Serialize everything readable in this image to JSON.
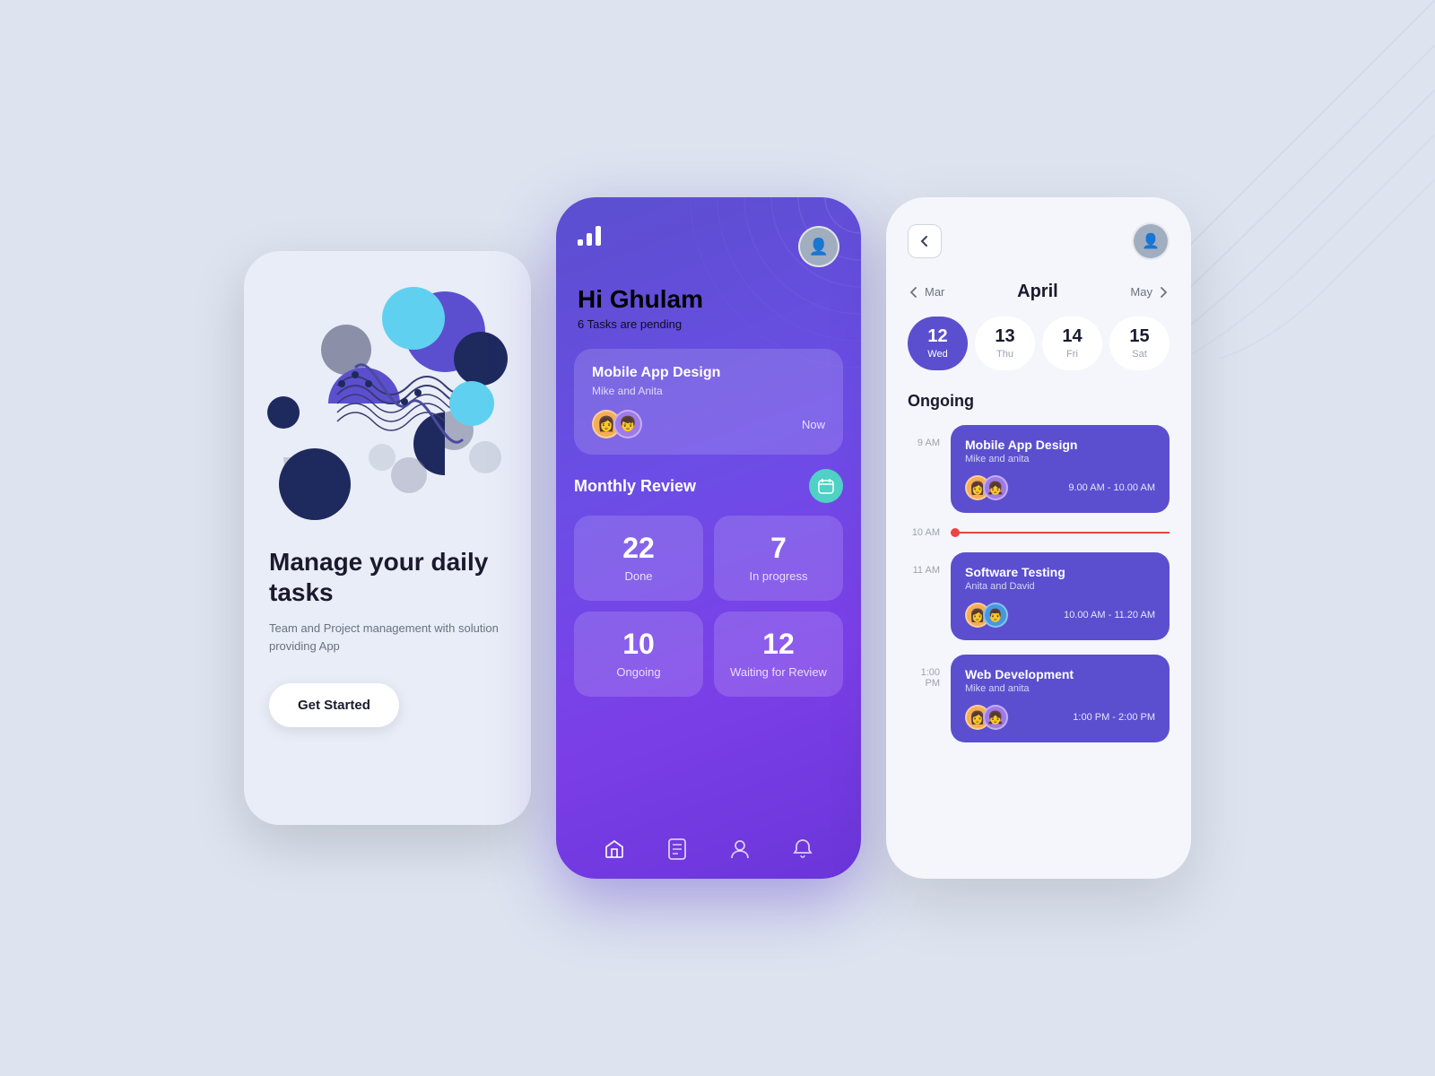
{
  "background": "#dde3ef",
  "phone1": {
    "title": "Manage your daily tasks",
    "description": "Team and Project management with solution providing App",
    "cta_label": "Get Started"
  },
  "phone2": {
    "greeting": "Hi Ghulam",
    "subtitle": "6 Tasks are pending",
    "task_card": {
      "title": "Mobile App Design",
      "people": "Mike and Anita",
      "time": "Now"
    },
    "review_section": {
      "title": "Monthly Review",
      "stats": [
        {
          "number": "22",
          "label": "Done"
        },
        {
          "number": "7",
          "label": "In progress"
        },
        {
          "number": "10",
          "label": "Ongoing"
        },
        {
          "number": "12",
          "label": "Waiting for Review"
        }
      ]
    },
    "nav_icons": [
      "home",
      "doc",
      "user",
      "bell"
    ]
  },
  "phone3": {
    "month": "April",
    "prev_month": "Mar",
    "next_month": "May",
    "days": [
      {
        "number": "12",
        "name": "Wed",
        "active": true
      },
      {
        "number": "13",
        "name": "Thu",
        "active": false
      },
      {
        "number": "14",
        "name": "Fri",
        "active": false
      },
      {
        "number": "15",
        "name": "Sat",
        "active": false
      }
    ],
    "ongoing_title": "Ongoing",
    "events": [
      {
        "time_label": "9 AM",
        "title": "Mobile App Design",
        "people": "Mike and anita",
        "time_range": "9.00 AM - 10.00 AM"
      },
      {
        "time_label": "11 AM",
        "title": "Software Testing",
        "people": "Anita and David",
        "time_range": "10.00 AM - 11.20 AM"
      },
      {
        "time_label": "1:00 PM",
        "title": "Web Development",
        "people": "Mike and anita",
        "time_range": "1:00 PM - 2:00 PM"
      }
    ],
    "current_time": "10 AM"
  }
}
